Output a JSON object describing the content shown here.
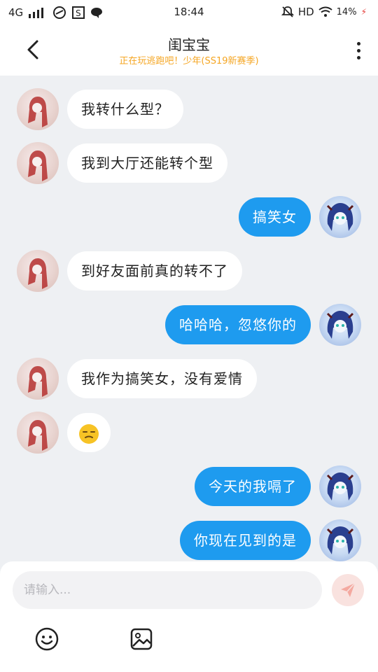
{
  "status_bar": {
    "network": "4G",
    "time": "18:44",
    "hd": "HD",
    "battery": "14%"
  },
  "header": {
    "title": "闺宝宝",
    "subtitle": "正在玩逃跑吧！少年(SS19新赛季)",
    "back_icon": "chevron-left-icon",
    "more_icon": "more-vertical-icon"
  },
  "messages": [
    {
      "side": "in",
      "text": "我转什么型？"
    },
    {
      "side": "in",
      "text": "我到大厅还能转个型"
    },
    {
      "side": "out",
      "text": "搞笑女"
    },
    {
      "side": "in",
      "text": "到好友面前真的转不了"
    },
    {
      "side": "out",
      "text": "哈哈哈，忽悠你的"
    },
    {
      "side": "in",
      "text": "我作为搞笑女，没有爱情"
    },
    {
      "side": "in",
      "text": "",
      "emoji": "unamused-face-emoji"
    },
    {
      "side": "out",
      "text": "今天的我嗝了"
    },
    {
      "side": "out",
      "text": "你现在见到的是"
    }
  ],
  "composer": {
    "placeholder": "请输入...",
    "send_icon": "send-icon",
    "emoji_icon": "smiley-icon",
    "image_icon": "image-icon"
  },
  "colors": {
    "accent": "#1e9bef",
    "subtitle": "#f5a623",
    "background": "#eef0f3"
  }
}
